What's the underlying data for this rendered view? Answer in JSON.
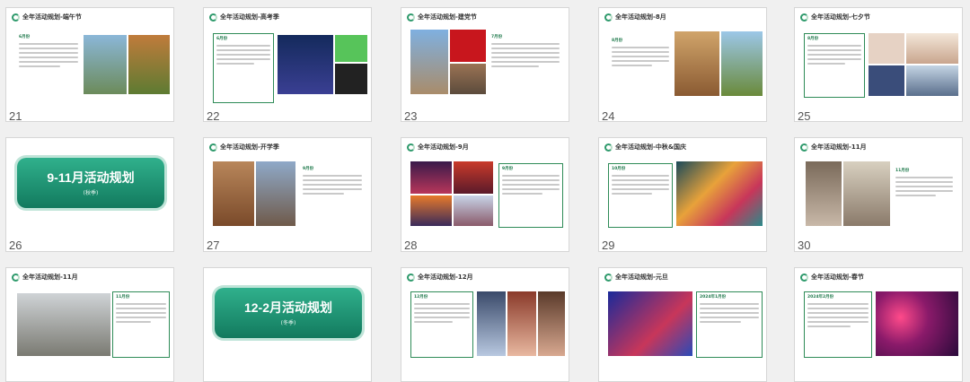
{
  "slides": [
    {
      "number": "21",
      "title": "全年活动规划-端午节",
      "label": "6月份"
    },
    {
      "number": "22",
      "title": "全年活动规划-高考季",
      "label": "6月份"
    },
    {
      "number": "23",
      "title": "全年活动规划-建党节",
      "label": "7月份"
    },
    {
      "number": "24",
      "title": "全年活动规划-8月",
      "label": "8月份"
    },
    {
      "number": "25",
      "title": "全年活动规划-七夕节",
      "label": "8月份"
    },
    {
      "number": "26",
      "banner_title": "9-11月活动规划",
      "banner_sub": "(秋季)"
    },
    {
      "number": "27",
      "title": "全年活动规划-开学季",
      "label": "9月份"
    },
    {
      "number": "28",
      "title": "全年活动规划-9月",
      "label": "9月份"
    },
    {
      "number": "29",
      "title": "全年活动规划-中秋&国庆",
      "label": "10月份"
    },
    {
      "number": "30",
      "title": "全年活动规划-11月",
      "label": "11月份"
    },
    {
      "number": "31",
      "title": "全年活动规划-11月",
      "label": "11月份"
    },
    {
      "number": "32",
      "banner_title": "12-2月活动规划",
      "banner_sub": "(冬季)"
    },
    {
      "number": "33",
      "title": "全年活动规划-12月",
      "label": "12月份"
    },
    {
      "number": "34",
      "title": "全年活动规划-元旦",
      "label": "2024年1月份"
    },
    {
      "number": "35",
      "title": "全年活动规划-春节",
      "label": "2024年2月份"
    }
  ],
  "colors": {
    "accent": "#2e8b57",
    "banner": "#1f9a78"
  }
}
